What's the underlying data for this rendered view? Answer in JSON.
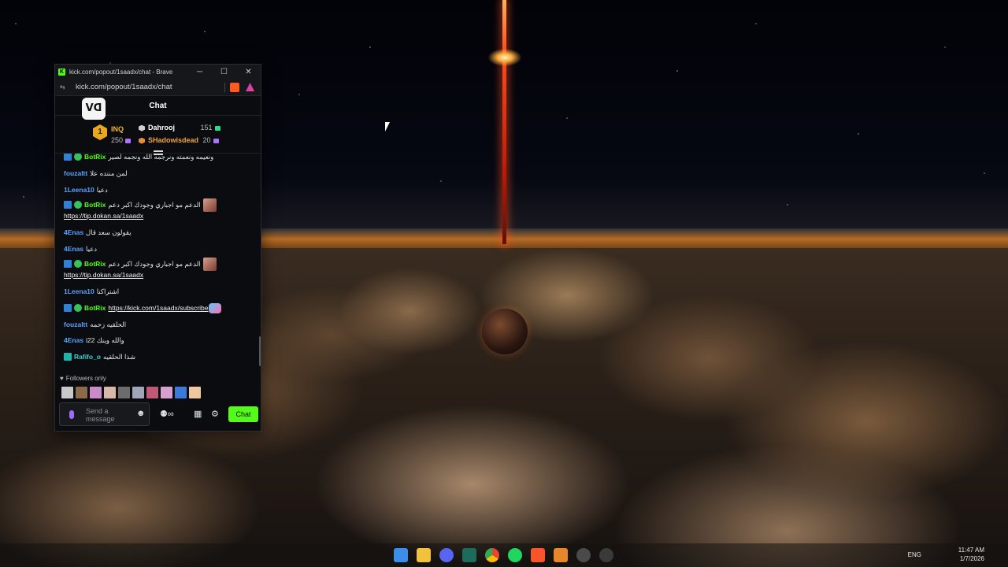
{
  "window": {
    "title": "kick.com/popout/1saadx/chat - Brave",
    "favicon": "K",
    "controls": {
      "minimize": "─",
      "maximize": "☐",
      "close": "✕"
    }
  },
  "address_bar": {
    "url": "kick.com/popout/1saadx/chat",
    "rewards_count": "1"
  },
  "chat": {
    "title": "Chat",
    "channel_logo": "V⁠ᗡ",
    "leaderboard": {
      "first": {
        "rank": "1",
        "name": "INQ",
        "count": "250"
      },
      "second": {
        "name": "Dahrooj",
        "count": "151"
      },
      "third": {
        "name": "SHadowisdead",
        "count": "20"
      }
    },
    "messages": [
      {
        "user": "BotRix",
        "text": "ونعيمه ونعمته ونرجمه الله ونجمه لصير"
      },
      {
        "user": "fouzaltt",
        "text": "لمن مننده علا"
      },
      {
        "user": "1Leena10",
        "text": "دعيا"
      },
      {
        "user": "BotRix",
        "text": "الدعم مو اجباري وجودك اكبر دعم",
        "link": "https://tip.dokan.sa/1saadx"
      },
      {
        "user": "4Enas",
        "text": "يقولون سعد قال"
      },
      {
        "user": "4Enas",
        "text": "دعيا"
      },
      {
        "user": "BotRix",
        "text": "الدعم مو اجباري وجودك اكبر دعم",
        "link": "https://tip.dokan.sa/1saadx"
      },
      {
        "user": "1Leena10",
        "text": "اشتراكنا"
      },
      {
        "user": "BotRix",
        "link": "https://kick.com/1saadx/subscribe"
      },
      {
        "user": "fouzaltt",
        "text": "الحلقيه زحمه"
      },
      {
        "user": "4Enas",
        "text": "i22 والله وينك"
      },
      {
        "user": "Rafifo_o",
        "text": "شذا الحلقيه"
      }
    ],
    "followers_only": "Followers only",
    "input": {
      "placeholder": "Send a message"
    },
    "tools": {
      "extension_label": "∞"
    },
    "send_button": "Chat"
  },
  "taskbar": {
    "language": "ENG",
    "time": "11:47 AM",
    "date": "1/7/2026"
  },
  "colors": {
    "kick_green": "#53fc18",
    "username_blue": "#5aa2ff",
    "gold": "#f5b52b",
    "bronze": "#e48c3c"
  }
}
